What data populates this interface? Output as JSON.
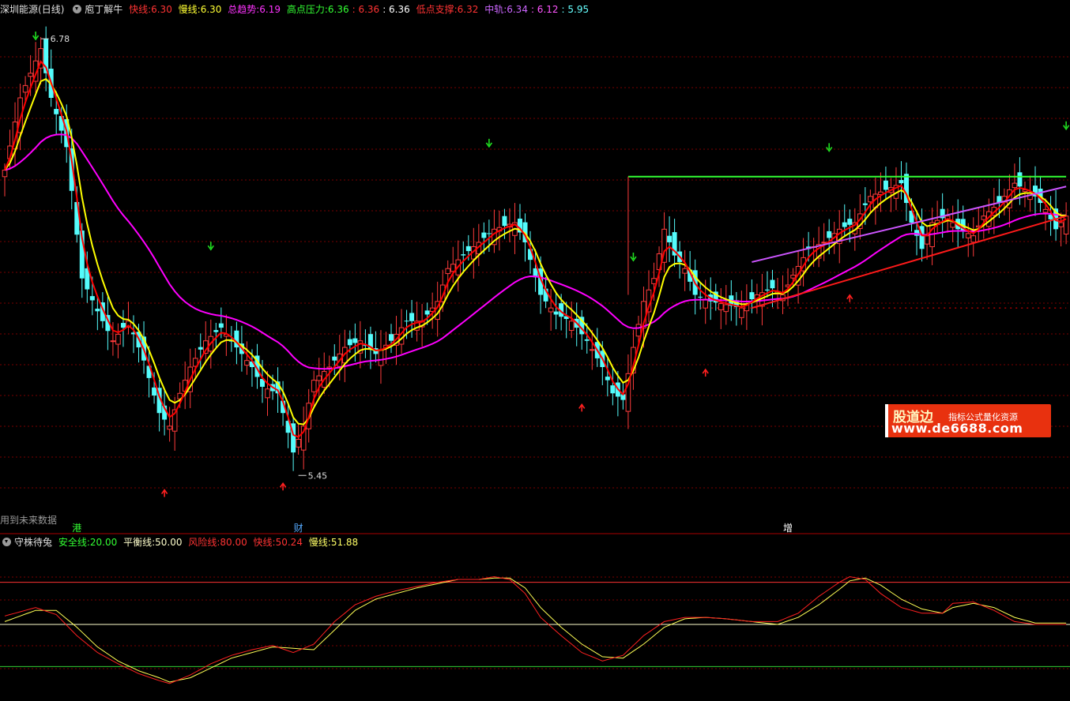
{
  "header": {
    "stock_name": "深圳能源",
    "period": "(日线)",
    "indicator_name": "庖丁解牛",
    "fast_label": "快线:",
    "fast_value": "6.30",
    "slow_label": "慢线:",
    "slow_value": "6.30",
    "trend_label": "总趋势:",
    "trend_value": "6.19",
    "resist_label": "高点压力:",
    "resist_v1": "6.36",
    "resist_v2": ": 6.36",
    "resist_v3": ": 6.36",
    "support_label": "低点支撑:",
    "support_value": "6.32",
    "mid_label": "中轨:",
    "mid_v1": "6.34",
    "mid_v2": ": 6.12",
    "mid_v3": ": 5.95"
  },
  "sub_header": {
    "indicator_name": "守株待兔",
    "safe_label": "安全线:",
    "safe_value": "20.00",
    "balance_label": "平衡线:",
    "balance_value": "50.00",
    "risk_label": "风险线:",
    "risk_value": "80.00",
    "fast_label": "快线:",
    "fast_value": "50.24",
    "slow_label": "慢线:",
    "slow_value": "51.88"
  },
  "future_data_note": "用到未来数据",
  "bottom_markers": [
    {
      "text": "港",
      "index": 14,
      "color": "#33ff33"
    },
    {
      "text": "财",
      "index": 57,
      "color": "#55aaff"
    },
    {
      "text": "增",
      "index": 152,
      "color": "#ffffff"
    }
  ],
  "watermark": {
    "brand": "股道边",
    "slogan": "指标公式量化资源",
    "site": "www.de6688.com"
  },
  "colors": {
    "up": "#ff3b3b",
    "down": "#54fcfc",
    "fast": "#ff0000",
    "slow": "#ffff00",
    "trend": "#ff00ff",
    "channel": "#cc55ff",
    "resist": "#33ff33",
    "support": "#ff0000",
    "buy_arrow": "#ff2020",
    "sell_arrow": "#20dd20",
    "grid": "#7a0000"
  },
  "chart_data": {
    "type": "candlestick",
    "count": 207,
    "ylim": [
      5.34,
      6.85
    ],
    "annotations": [
      {
        "text": "6.78",
        "index": 7,
        "price": 6.78
      },
      {
        "text": "5.45",
        "index": 57,
        "price": 5.45
      }
    ],
    "keypoints": [
      [
        0,
        6.38
      ],
      [
        3,
        6.6
      ],
      [
        7,
        6.75
      ],
      [
        9,
        6.6
      ],
      [
        12,
        6.45
      ],
      [
        15,
        6.05
      ],
      [
        18,
        5.95
      ],
      [
        21,
        5.86
      ],
      [
        24,
        5.92
      ],
      [
        27,
        5.8
      ],
      [
        30,
        5.64
      ],
      [
        32,
        5.6
      ],
      [
        34,
        5.7
      ],
      [
        36,
        5.78
      ],
      [
        39,
        5.86
      ],
      [
        42,
        5.9
      ],
      [
        45,
        5.84
      ],
      [
        48,
        5.78
      ],
      [
        50,
        5.72
      ],
      [
        53,
        5.7
      ],
      [
        56,
        5.52
      ],
      [
        58,
        5.6
      ],
      [
        60,
        5.74
      ],
      [
        63,
        5.78
      ],
      [
        66,
        5.84
      ],
      [
        69,
        5.86
      ],
      [
        72,
        5.82
      ],
      [
        75,
        5.86
      ],
      [
        78,
        5.92
      ],
      [
        81,
        5.92
      ],
      [
        84,
        5.98
      ],
      [
        86,
        6.08
      ],
      [
        89,
        6.12
      ],
      [
        92,
        6.16
      ],
      [
        95,
        6.2
      ],
      [
        99,
        6.22
      ],
      [
        101,
        6.16
      ],
      [
        104,
        6.0
      ],
      [
        107,
        5.94
      ],
      [
        110,
        5.92
      ],
      [
        113,
        5.86
      ],
      [
        116,
        5.78
      ],
      [
        118,
        5.7
      ],
      [
        120,
        5.68
      ],
      [
        122,
        5.84
      ],
      [
        124,
        5.98
      ],
      [
        126,
        6.05
      ],
      [
        128,
        6.2
      ],
      [
        130,
        6.12
      ],
      [
        132,
        6.08
      ],
      [
        134,
        6.0
      ],
      [
        137,
        5.98
      ],
      [
        140,
        5.97
      ],
      [
        143,
        5.96
      ],
      [
        146,
        6.0
      ],
      [
        149,
        6.02
      ],
      [
        151,
        6.0
      ],
      [
        153,
        6.06
      ],
      [
        156,
        6.14
      ],
      [
        159,
        6.16
      ],
      [
        162,
        6.2
      ],
      [
        165,
        6.22
      ],
      [
        168,
        6.3
      ],
      [
        171,
        6.32
      ],
      [
        174,
        6.34
      ],
      [
        176,
        6.22
      ],
      [
        178,
        6.14
      ],
      [
        180,
        6.22
      ],
      [
        183,
        6.24
      ],
      [
        185,
        6.2
      ],
      [
        188,
        6.18
      ],
      [
        190,
        6.24
      ],
      [
        193,
        6.28
      ],
      [
        196,
        6.34
      ],
      [
        198,
        6.32
      ],
      [
        200,
        6.3
      ],
      [
        202,
        6.26
      ],
      [
        204,
        6.2
      ],
      [
        206,
        6.24
      ]
    ],
    "sell_signals": [
      6,
      40,
      94,
      122,
      160,
      206
    ],
    "buy_signals": [
      31,
      54,
      112,
      136,
      164
    ],
    "resistance_line": {
      "from_index": 121,
      "to_index": 206,
      "value": 6.36
    },
    "support_line": {
      "from_index": 135,
      "to_index": 206,
      "value": 5.96
    },
    "sub": {
      "ylim": [
        0,
        100
      ],
      "levels": [
        20,
        50,
        80
      ],
      "fast_keypoints": [
        [
          0,
          56
        ],
        [
          6,
          62
        ],
        [
          10,
          57
        ],
        [
          14,
          42
        ],
        [
          18,
          30
        ],
        [
          22,
          22
        ],
        [
          26,
          15
        ],
        [
          30,
          10
        ],
        [
          32,
          8
        ],
        [
          36,
          14
        ],
        [
          40,
          22
        ],
        [
          44,
          28
        ],
        [
          48,
          32
        ],
        [
          52,
          35
        ],
        [
          56,
          30
        ],
        [
          60,
          36
        ],
        [
          64,
          52
        ],
        [
          68,
          64
        ],
        [
          72,
          70
        ],
        [
          76,
          74
        ],
        [
          80,
          77
        ],
        [
          84,
          80
        ],
        [
          88,
          82
        ],
        [
          92,
          82
        ],
        [
          95,
          84
        ],
        [
          98,
          82
        ],
        [
          101,
          72
        ],
        [
          104,
          55
        ],
        [
          108,
          42
        ],
        [
          112,
          30
        ],
        [
          116,
          24
        ],
        [
          120,
          28
        ],
        [
          124,
          42
        ],
        [
          128,
          52
        ],
        [
          132,
          55
        ],
        [
          136,
          55
        ],
        [
          140,
          54
        ],
        [
          145,
          52
        ],
        [
          150,
          52
        ],
        [
          154,
          58
        ],
        [
          158,
          70
        ],
        [
          162,
          80
        ],
        [
          164,
          84
        ],
        [
          167,
          82
        ],
        [
          170,
          72
        ],
        [
          174,
          62
        ],
        [
          178,
          58
        ],
        [
          182,
          58
        ],
        [
          184,
          65
        ],
        [
          188,
          66
        ],
        [
          192,
          60
        ],
        [
          196,
          52
        ],
        [
          200,
          50
        ]
      ],
      "slow_keypoints": [
        [
          0,
          52
        ],
        [
          6,
          60
        ],
        [
          10,
          60
        ],
        [
          14,
          48
        ],
        [
          18,
          34
        ],
        [
          22,
          24
        ],
        [
          26,
          17
        ],
        [
          30,
          12
        ],
        [
          32,
          9
        ],
        [
          36,
          12
        ],
        [
          40,
          19
        ],
        [
          44,
          26
        ],
        [
          48,
          30
        ],
        [
          52,
          34
        ],
        [
          56,
          33
        ],
        [
          60,
          32
        ],
        [
          64,
          46
        ],
        [
          68,
          60
        ],
        [
          72,
          68
        ],
        [
          76,
          72
        ],
        [
          80,
          76
        ],
        [
          84,
          79
        ],
        [
          88,
          82
        ],
        [
          92,
          82
        ],
        [
          95,
          83
        ],
        [
          98,
          83
        ],
        [
          101,
          76
        ],
        [
          104,
          62
        ],
        [
          108,
          48
        ],
        [
          112,
          36
        ],
        [
          116,
          27
        ],
        [
          120,
          26
        ],
        [
          124,
          36
        ],
        [
          128,
          48
        ],
        [
          132,
          54
        ],
        [
          136,
          55
        ],
        [
          140,
          54
        ],
        [
          145,
          52
        ],
        [
          150,
          50
        ],
        [
          154,
          55
        ],
        [
          158,
          64
        ],
        [
          162,
          75
        ],
        [
          164,
          81
        ],
        [
          167,
          83
        ],
        [
          170,
          78
        ],
        [
          174,
          68
        ],
        [
          178,
          61
        ],
        [
          182,
          58
        ],
        [
          184,
          62
        ],
        [
          188,
          65
        ],
        [
          192,
          62
        ],
        [
          196,
          55
        ],
        [
          200,
          51
        ]
      ]
    }
  }
}
